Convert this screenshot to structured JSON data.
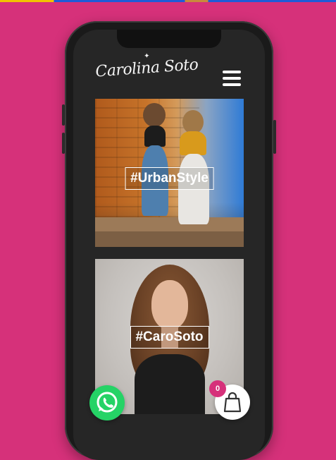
{
  "brand": {
    "logo_text": "Carolina Soto",
    "logo_star": "✦"
  },
  "icons": {
    "menu": "hamburger-menu-icon",
    "whatsapp": "whatsapp-icon",
    "cart": "shopping-bag-icon"
  },
  "colors": {
    "background": "#d6317a",
    "screen": "#262626",
    "whatsapp": "#25d366",
    "badge": "#d6317a"
  },
  "cards": [
    {
      "tag": "#UrbanStyle"
    },
    {
      "tag": "#CaroSoto"
    }
  ],
  "cart": {
    "count": "0"
  }
}
